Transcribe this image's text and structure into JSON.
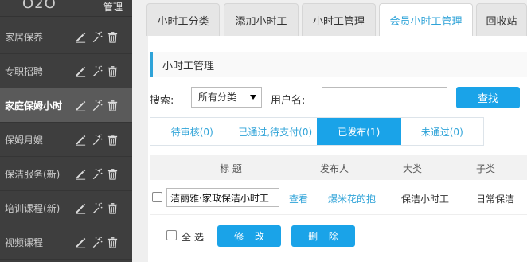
{
  "sidebar": {
    "logo": "O2O",
    "manage_label": "管理",
    "items": [
      {
        "label": "家居保养"
      },
      {
        "label": "专职招聘"
      },
      {
        "label": "家庭保姆小时"
      },
      {
        "label": "保姆月嫂"
      },
      {
        "label": "保洁服务(新)"
      },
      {
        "label": "培训课程(新)"
      },
      {
        "label": "视频课程"
      }
    ]
  },
  "tabs": [
    {
      "label": "小时工分类"
    },
    {
      "label": "添加小时工"
    },
    {
      "label": "小时工管理"
    },
    {
      "label": "会员小时工管理"
    },
    {
      "label": "回收站"
    }
  ],
  "panel": {
    "title": "小时工管理",
    "search": {
      "label": "搜索:",
      "category_selected": "所有分类",
      "username_label": "用户名:",
      "username_value": "",
      "find_button": "查找"
    },
    "status_tabs": [
      {
        "label": "待审核(0)"
      },
      {
        "label": "已通过,待支付(0)"
      },
      {
        "label": "已发布(1)"
      },
      {
        "label": "未通过(0)"
      }
    ],
    "table": {
      "headers": [
        "标 题",
        "发布人",
        "大类",
        "子类"
      ],
      "rows": [
        {
          "title": "洁丽雅·家政保洁小时工",
          "action": "查看",
          "publisher": "爆米花的抱",
          "category": "保洁小时工",
          "subcategory": "日常保洁"
        }
      ]
    },
    "select_all_label": "全 选",
    "edit_button": "修 改",
    "delete_button": "删 除"
  },
  "colors": {
    "accent": "#1aa3e8",
    "sidebar_bg": "#3e3e3e",
    "sidebar_active_bg": "#5a5a5a"
  },
  "icons": [
    "edit-icon",
    "magic-wand-icon",
    "trash-icon",
    "dropdown-arrow-icon"
  ]
}
